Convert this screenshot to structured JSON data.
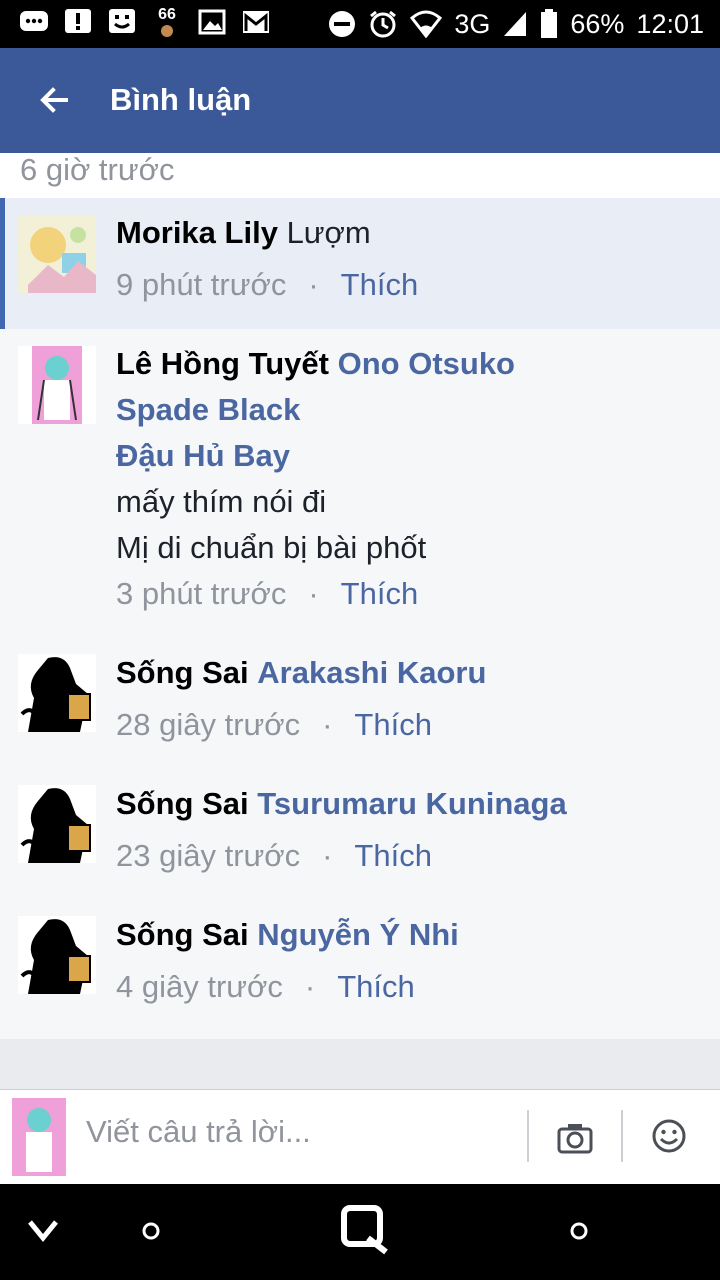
{
  "status_bar": {
    "notification_count": "66",
    "network": "3G",
    "battery": "66%",
    "time": "12:01"
  },
  "app_bar": {
    "title": "Bình luận"
  },
  "previous_timestamp": "6 giờ trước",
  "comments": [
    {
      "author": "Morika Lily",
      "tags": [],
      "lines": [
        "Lượm"
      ],
      "time": "9 phút trước",
      "like_label": "Thích"
    },
    {
      "author": "Lê Hồng Tuyết",
      "tags": [
        "Ono Otsuko",
        "Spade Black",
        "Đậu Hủ Bay"
      ],
      "lines": [
        "mấy thím nói đi",
        "Mị di chuẩn bị bài phốt"
      ],
      "time": "3 phút trước",
      "like_label": "Thích"
    },
    {
      "author": "Sống Sai",
      "tags": [
        "Arakashi Kaoru"
      ],
      "lines": [],
      "time": "28 giây trước",
      "like_label": "Thích"
    },
    {
      "author": "Sống Sai",
      "tags": [
        "Tsurumaru Kuninaga"
      ],
      "lines": [],
      "time": "23 giây trước",
      "like_label": "Thích"
    },
    {
      "author": "Sống Sai",
      "tags": [
        "Nguyễn Ý Nhi"
      ],
      "lines": [],
      "time": "4 giây trước",
      "like_label": "Thích"
    }
  ],
  "meta_separator": "·",
  "reply_bar": {
    "placeholder": "Viết câu trả lời...",
    "camera_icon": "camera-icon",
    "emoji_icon": "smiley-icon"
  },
  "colors": {
    "brand_blue": "#3b5998",
    "link_blue": "#4b67a1",
    "meta_gray": "#90949c"
  }
}
